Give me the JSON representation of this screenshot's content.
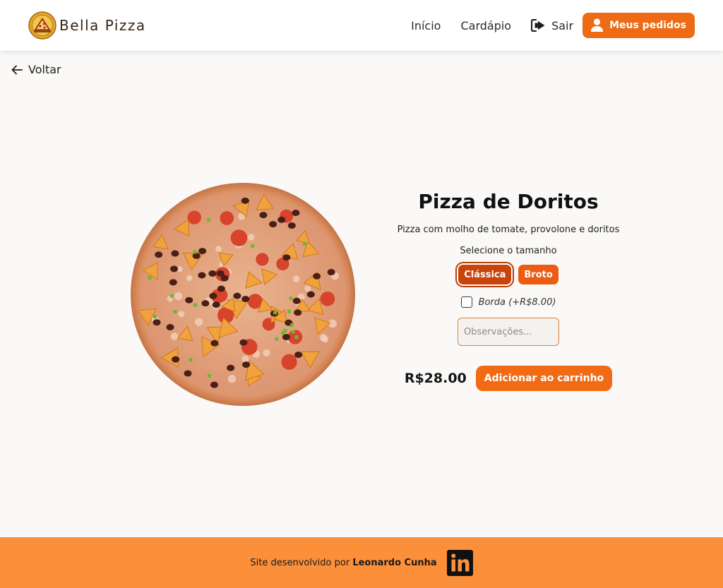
{
  "header": {
    "brand_name": "Bella Pizza",
    "nav": {
      "inicio": "Início",
      "cardapio": "Cardápio",
      "sair": "Sair",
      "meus_pedidos": "Meus pedidos"
    }
  },
  "back_label": "Voltar",
  "product": {
    "name": "Pizza de Doritos",
    "description": "Pizza com molho de tomate, provolone e doritos",
    "size_prompt": "Selecione o tamanho",
    "sizes": [
      {
        "label": "Clássica",
        "selected": true
      },
      {
        "label": "Broto",
        "selected": false
      }
    ],
    "borda_label": "Borda (+R$8.00)",
    "borda_checked": false,
    "observations_placeholder": "Observações...",
    "observations_value": "",
    "price": "R$28.00",
    "add_to_cart_label": "Adicionar ao carrinho"
  },
  "footer": {
    "text": "Site desenvolvido por",
    "author": "Leonardo Cunha"
  },
  "icons": {
    "logout": "sign-out-icon",
    "orders": "user-icon",
    "back": "arrow-left-icon",
    "social": "linkedin-icon"
  },
  "colors": {
    "accent": "#ee6a14",
    "accent_dark": "#c9440a",
    "footer": "#fb8f3a",
    "background": "#faf9f7"
  }
}
